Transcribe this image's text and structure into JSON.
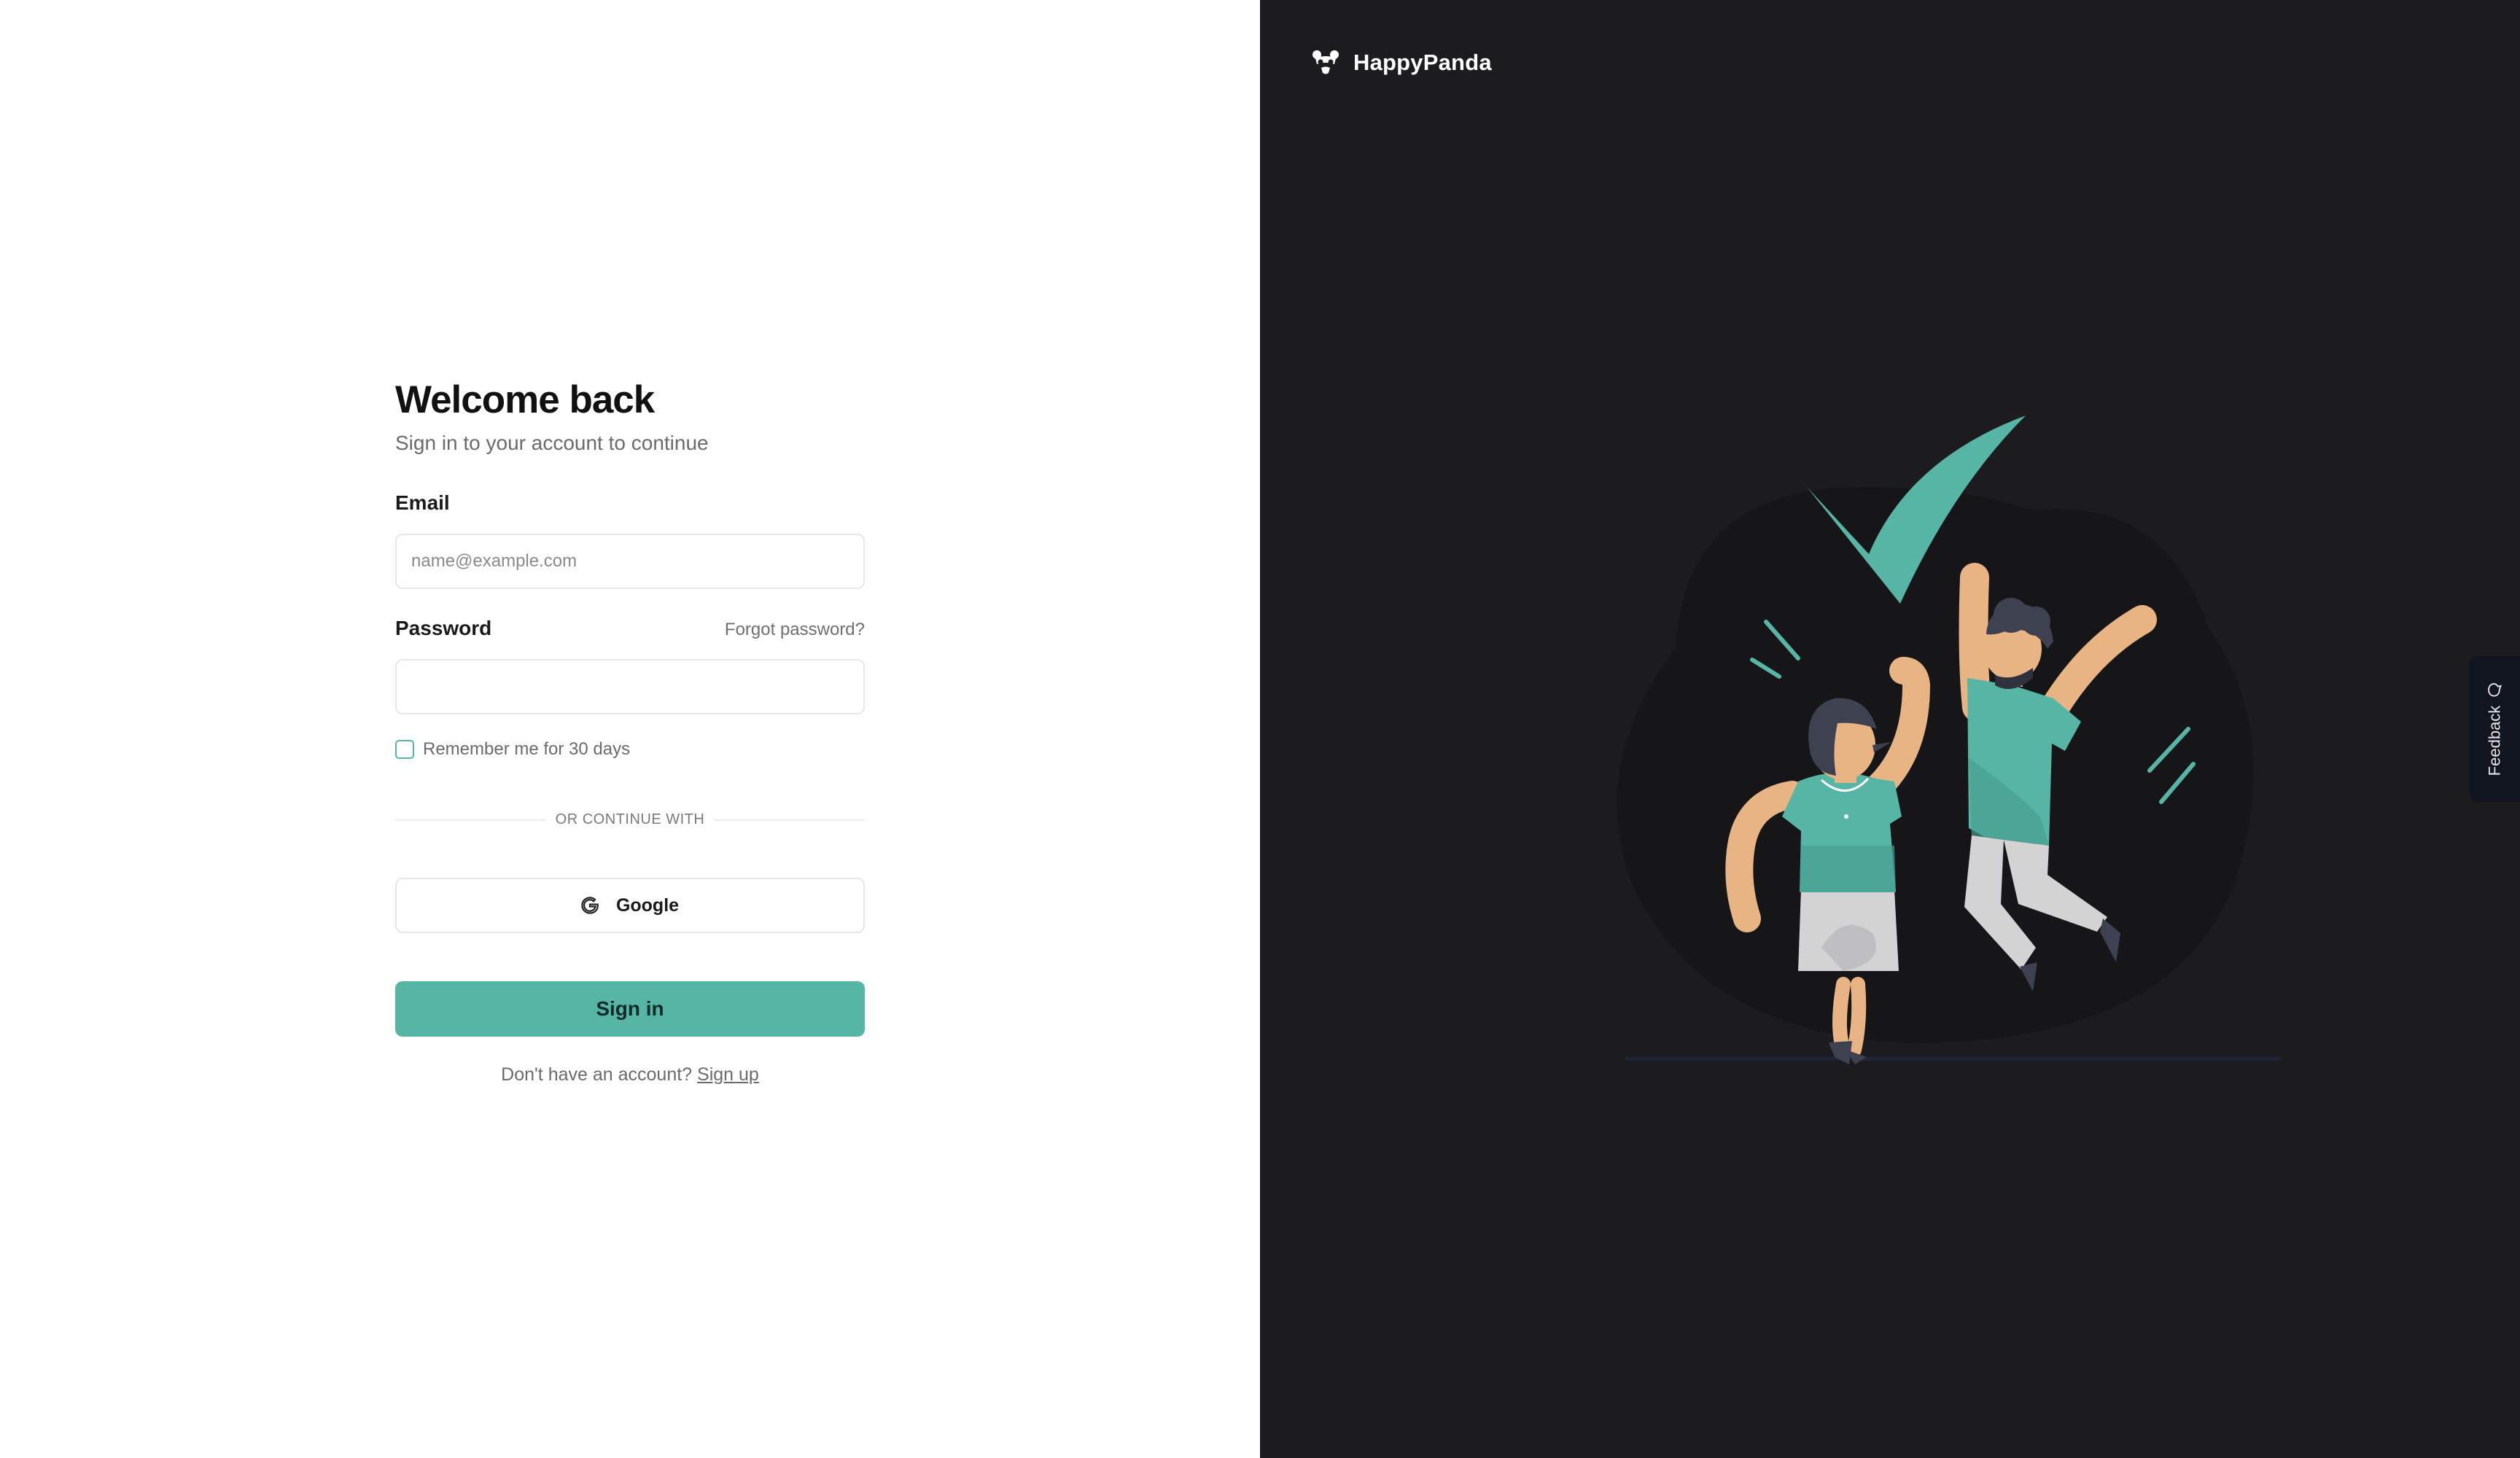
{
  "login": {
    "title": "Welcome back",
    "subtitle": "Sign in to your account to continue",
    "email_label": "Email",
    "email_placeholder": "name@example.com",
    "email_value": "",
    "password_label": "Password",
    "password_value": "",
    "forgot_password": "Forgot password?",
    "remember_me": "Remember me for 30 days",
    "remember_checked": false,
    "divider_text": "OR CONTINUE WITH",
    "google_button": "Google",
    "google_icon": "google-icon",
    "signin_button": "Sign in",
    "signup_prompt": "Don't have an account?",
    "signup_link": "Sign up"
  },
  "brand": {
    "name": "HappyPanda",
    "logo_icon": "panda-logo-icon"
  },
  "feedback": {
    "label": "Feedback",
    "icon": "chat-bubble-icon"
  },
  "colors": {
    "accent": "#57b5a6",
    "right_panel_bg": "#1c1c1e",
    "skin": "#e8b483",
    "hair": "#3e4150"
  }
}
